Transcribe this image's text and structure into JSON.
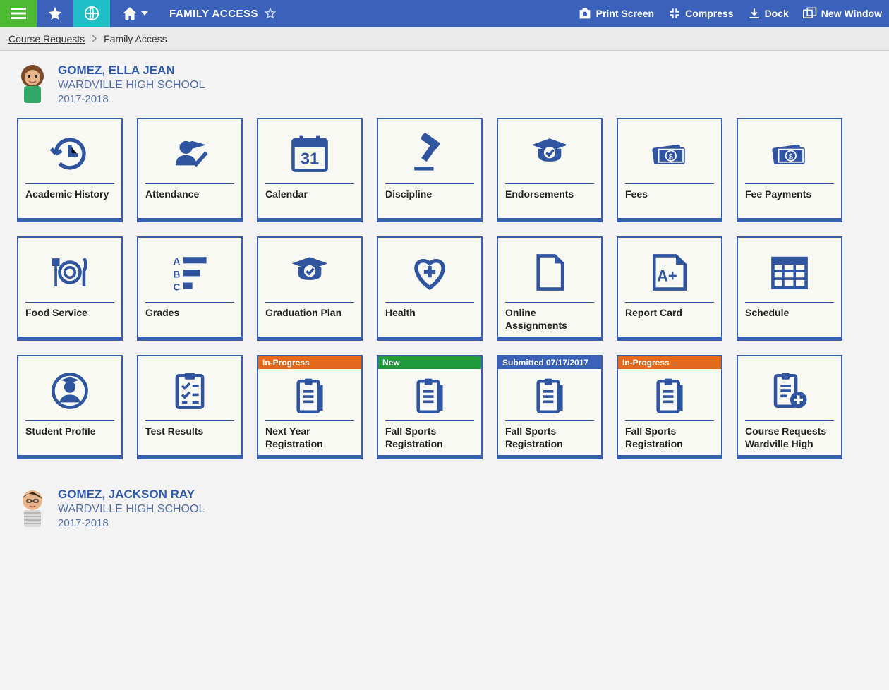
{
  "topbar": {
    "title": "FAMILY ACCESS",
    "actions": {
      "print": "Print Screen",
      "compress": "Compress",
      "dock": "Dock",
      "newwindow": "New Window"
    }
  },
  "breadcrumb": {
    "link": "Course Requests",
    "current": "Family Access"
  },
  "students": [
    {
      "name": "GOMEZ, ELLA JEAN",
      "school": "WARDVILLE HIGH SCHOOL",
      "year": "2017-2018",
      "tiles": [
        {
          "id": "academic-history",
          "label": "Academic History",
          "icon": "history"
        },
        {
          "id": "attendance",
          "label": "Attendance",
          "icon": "grad-check"
        },
        {
          "id": "calendar",
          "label": "Calendar",
          "icon": "calendar"
        },
        {
          "id": "discipline",
          "label": "Discipline",
          "icon": "gavel"
        },
        {
          "id": "endorsements",
          "label": "Endorsements",
          "icon": "cap-check"
        },
        {
          "id": "fees",
          "label": "Fees",
          "icon": "money"
        },
        {
          "id": "fee-payments",
          "label": "Fee Payments",
          "icon": "money"
        },
        {
          "id": "food-service",
          "label": "Food Service",
          "icon": "food"
        },
        {
          "id": "grades",
          "label": "Grades",
          "icon": "abc"
        },
        {
          "id": "graduation-plan",
          "label": "Graduation Plan",
          "icon": "cap-check"
        },
        {
          "id": "health",
          "label": "Health",
          "icon": "heart"
        },
        {
          "id": "online-assign",
          "label": "Online Assignments",
          "icon": "file"
        },
        {
          "id": "report-card",
          "label": "Report Card",
          "icon": "aplus"
        },
        {
          "id": "schedule",
          "label": "Schedule",
          "icon": "schedule"
        },
        {
          "id": "student-profile",
          "label": "Student Profile",
          "icon": "profile"
        },
        {
          "id": "test-results",
          "label": "Test Results",
          "icon": "checklist"
        },
        {
          "id": "next-year-reg",
          "label": "Next Year Registration",
          "icon": "clipboard",
          "badge": {
            "text": "In-Progress",
            "color": "orange"
          }
        },
        {
          "id": "fall-sports-new",
          "label": "Fall Sports Registration",
          "icon": "clipboard",
          "badge": {
            "text": "New",
            "color": "green"
          }
        },
        {
          "id": "fall-sports-sub",
          "label": "Fall Sports Registration",
          "icon": "clipboard",
          "badge": {
            "text": "Submitted 07/17/2017",
            "color": "blue"
          }
        },
        {
          "id": "fall-sports-ip",
          "label": "Fall Sports Registration",
          "icon": "clipboard",
          "badge": {
            "text": "In-Progress",
            "color": "orange"
          }
        },
        {
          "id": "course-req",
          "label": "Course Requests Wardville High",
          "icon": "clipboard-plus"
        }
      ]
    },
    {
      "name": "GOMEZ, JACKSON RAY",
      "school": "WARDVILLE HIGH SCHOOL",
      "year": "2017-2018",
      "tiles": []
    }
  ],
  "colors": {
    "brand": "#3a62ba",
    "deep": "#2f54a0",
    "green": "#4cb933",
    "cyan": "#1fbfc7",
    "orange": "#e26a1a",
    "badgegreen": "#1f9b3d"
  }
}
